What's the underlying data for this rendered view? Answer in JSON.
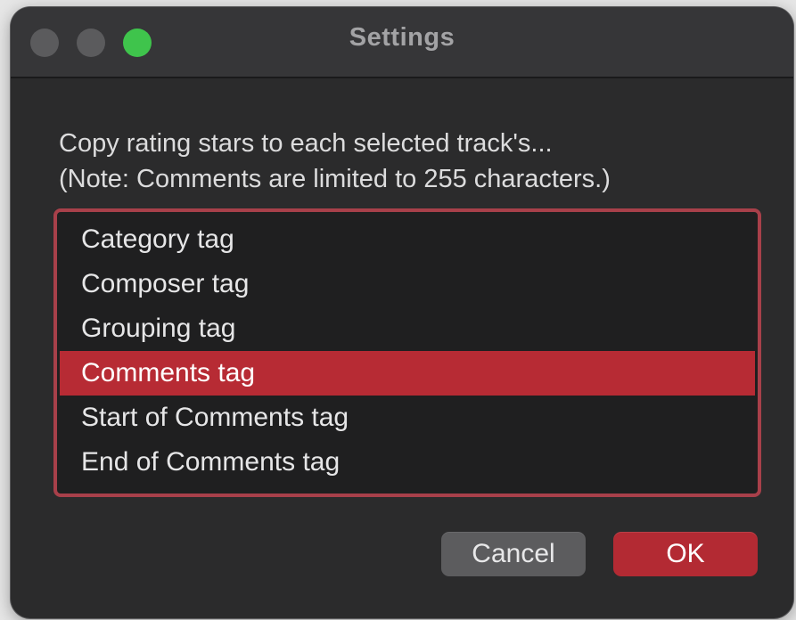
{
  "window": {
    "title": "Settings"
  },
  "prompt": {
    "line1": "Copy rating stars to each selected track's...",
    "line2": "(Note: Comments are limited to 255 characters.)"
  },
  "list": {
    "items": [
      {
        "label": "Category tag"
      },
      {
        "label": "Composer tag"
      },
      {
        "label": "Grouping tag"
      },
      {
        "label": "Comments tag"
      },
      {
        "label": "Start of Comments tag"
      },
      {
        "label": "End of Comments tag"
      }
    ],
    "selected_label": "Comments tag"
  },
  "buttons": {
    "cancel_label": "Cancel",
    "ok_label": "OK"
  },
  "colors": {
    "accent": "#b72b34",
    "window_background": "#2b2b2c",
    "list_background": "#1f1f20",
    "zoom_light": "#3fc44c"
  }
}
